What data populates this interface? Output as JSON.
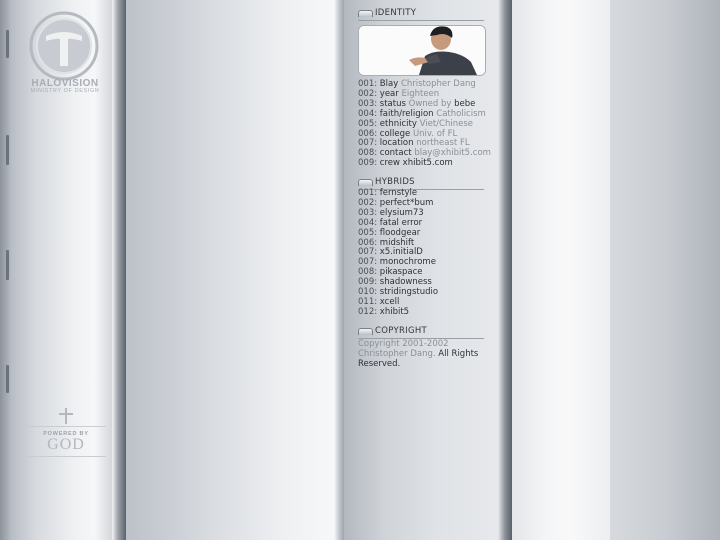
{
  "logo": {
    "title": "HALOVISION",
    "subtitle": "MINISTRY OF DESIGN"
  },
  "powered": {
    "label": "POWERED BY",
    "name": "GOD"
  },
  "identity": {
    "header": "IDENTITY",
    "rows": [
      {
        "num": "001:",
        "key": "Blay",
        "val": "Christopher Dang"
      },
      {
        "num": "002:",
        "key": "year",
        "val": "Eighteen"
      },
      {
        "num": "003:",
        "key": "status",
        "val": "Owned by",
        "extra": "bebe"
      },
      {
        "num": "004:",
        "key": "faith/religion",
        "val": "Catholicism"
      },
      {
        "num": "005:",
        "key": "ethnicity",
        "val": "Viet/Chinese"
      },
      {
        "num": "006:",
        "key": "college",
        "val": "Univ. of FL"
      },
      {
        "num": "007:",
        "key": "location",
        "val": "northeast FL"
      },
      {
        "num": "008:",
        "key": "contact",
        "val": "blay@xhibit5.com"
      },
      {
        "num": "009:",
        "key": "crew",
        "val": "xhibit5.com"
      }
    ]
  },
  "hybrids": {
    "header": "HYBRIDS",
    "rows": [
      {
        "num": "001:",
        "name": "fernstyle"
      },
      {
        "num": "002:",
        "name": "perfect*bum"
      },
      {
        "num": "003:",
        "name": "elysium73"
      },
      {
        "num": "004:",
        "name": "fatal error"
      },
      {
        "num": "005:",
        "name": "floodgear"
      },
      {
        "num": "006:",
        "name": "midshift"
      },
      {
        "num": "007:",
        "name": "x5.initialD"
      },
      {
        "num": "007:",
        "name": "monochrome"
      },
      {
        "num": "008:",
        "name": "pikaspace"
      },
      {
        "num": "009:",
        "name": "shadowness"
      },
      {
        "num": "010:",
        "name": "stridingstudio"
      },
      {
        "num": "011:",
        "name": "xcell"
      },
      {
        "num": "012:",
        "name": "xhibit5"
      }
    ]
  },
  "copyright": {
    "header": "COPYRIGHT",
    "text": "Copyright 2001-2002 Christopher Dang.",
    "rights": "All Rights Reserved."
  }
}
